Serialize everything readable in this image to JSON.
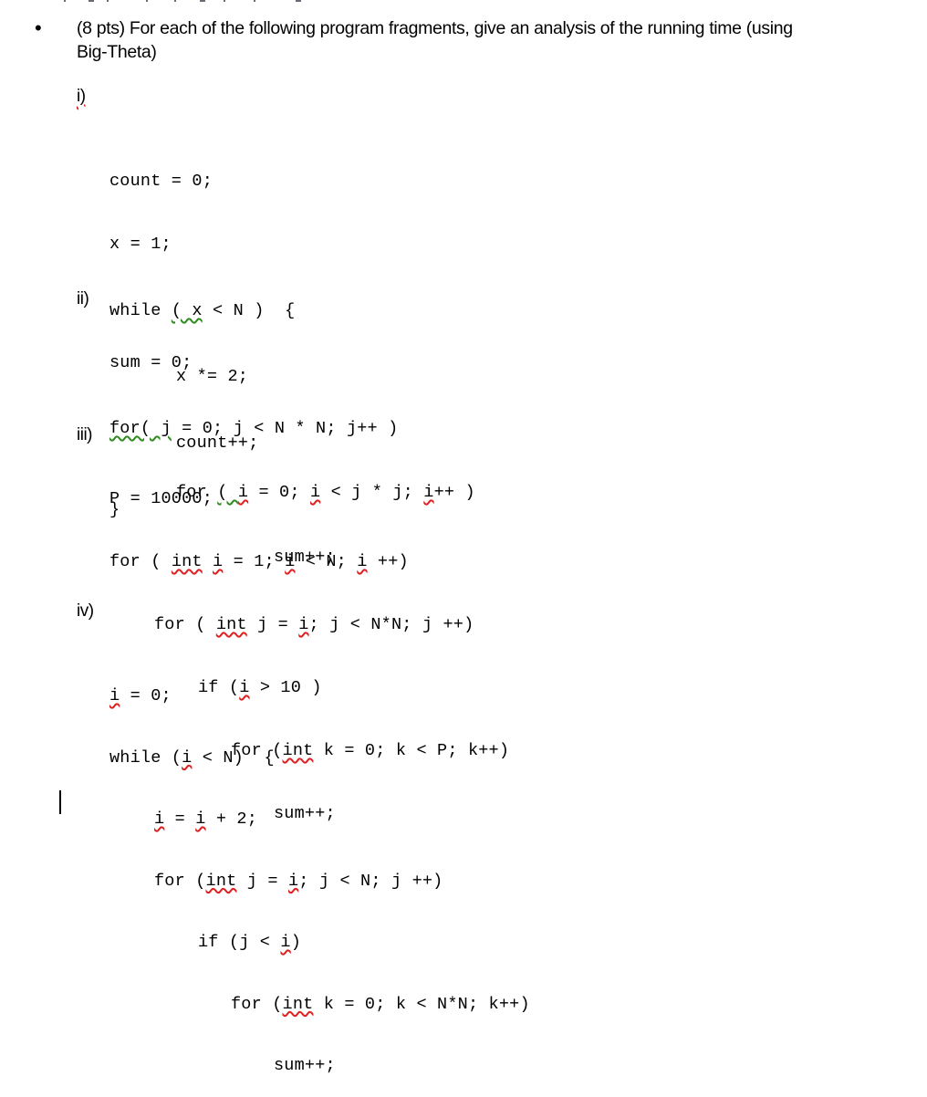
{
  "question": {
    "bullet": "•",
    "text_line1": "(8 pts) For each of the following program fragments, give an analysis of the running time (using",
    "text_line2": "Big-Theta)"
  },
  "sections": [
    {
      "label": "i)",
      "code": [
        "count = 0;",
        "x = 1;",
        "while ( x < N ) {",
        "x *= 2;",
        "count++;",
        "}"
      ]
    },
    {
      "label": "ii)",
      "code": [
        "sum = 0;",
        "for( j = 0; j < N * N; j++ )",
        "for ( i = 0; i < j * j; i++ )",
        "sum++;"
      ]
    },
    {
      "label": "iii)",
      "code": [
        "P = 10000;",
        "for ( int i = 1; i < N; i ++)",
        "for ( int j = i; j < N*N; j ++)",
        "if (i > 10 )",
        "for (int k = 0; k < P; k++)",
        "sum++;"
      ]
    },
    {
      "label": "iv)",
      "code": [
        "i = 0;",
        "while (i < N) {",
        "i = i + 2;",
        "for (int j = i; j < N; j ++)",
        "if (j < i)",
        "for (int k = 0; k < N*N; k++)",
        "sum++;"
      ]
    }
  ],
  "colors": {
    "spelling_error": "#e02020",
    "grammar_error": "#2e8b1e"
  }
}
